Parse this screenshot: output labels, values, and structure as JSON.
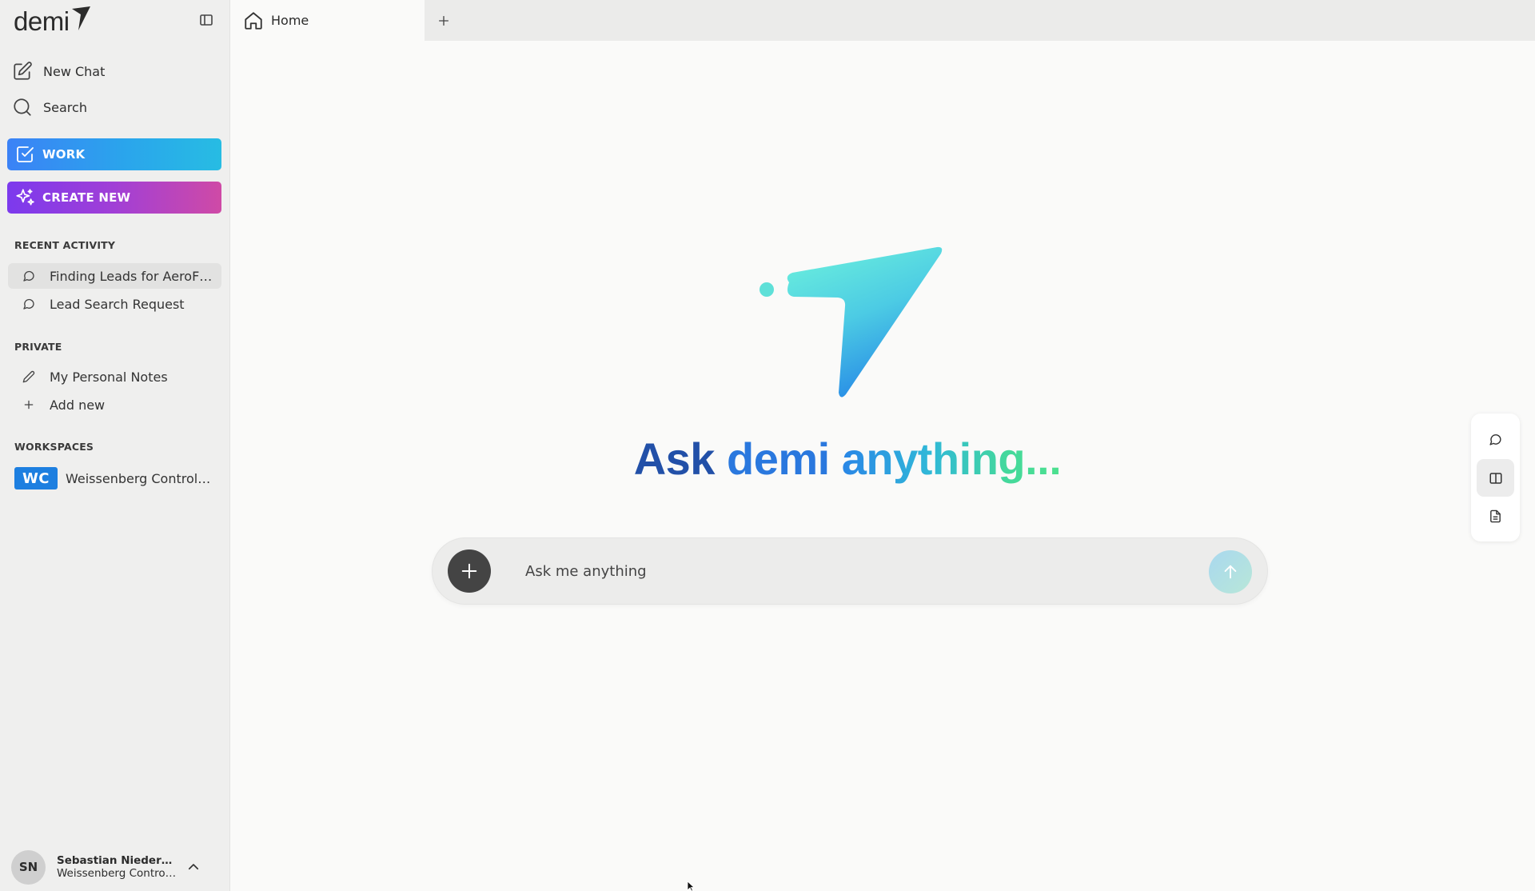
{
  "app": {
    "logo_text": "demi",
    "colors": {
      "work_gradient_start": "#3b82f6",
      "work_gradient_end": "#27bce3",
      "create_gradient_start": "#7c3aed",
      "create_gradient_end": "#cf4aa6",
      "workspace_badge": "#1d7fe0"
    }
  },
  "sidebar": {
    "collapse_icon": "sidebar-toggle-icon",
    "nav": [
      {
        "label": "New Chat",
        "icon": "edit-icon"
      },
      {
        "label": "Search",
        "icon": "search-icon"
      }
    ],
    "work_label": "WORK",
    "create_label": "CREATE NEW",
    "recent_heading": "RECENT ACTIVITY",
    "recent": [
      {
        "label": "Finding Leads for AeroFl...",
        "icon": "chat-bubble-icon",
        "active": true
      },
      {
        "label": "Lead Search Request",
        "icon": "chat-bubble-icon",
        "active": false
      }
    ],
    "private_heading": "PRIVATE",
    "private": [
      {
        "label": "My Personal Notes",
        "icon": "pencil-icon"
      },
      {
        "label": "Add new",
        "icon": "plus-icon"
      }
    ],
    "workspaces_heading": "WORKSPACES",
    "workspaces": [
      {
        "badge": "WC",
        "label": "Weissenberg Control ..."
      }
    ],
    "user": {
      "initials": "SN",
      "name": "Sebastian Niederdec...",
      "org": "Weissenberg Control ..."
    }
  },
  "tabs": [
    {
      "label": "Home",
      "icon": "home-icon",
      "active": true
    }
  ],
  "main": {
    "hero_words": [
      "Ask",
      "demi",
      "anything..."
    ],
    "composer": {
      "placeholder": "Ask me anything",
      "value": ""
    },
    "right_panel": [
      "chat-bubble-icon",
      "split-view-icon",
      "document-icon"
    ]
  }
}
